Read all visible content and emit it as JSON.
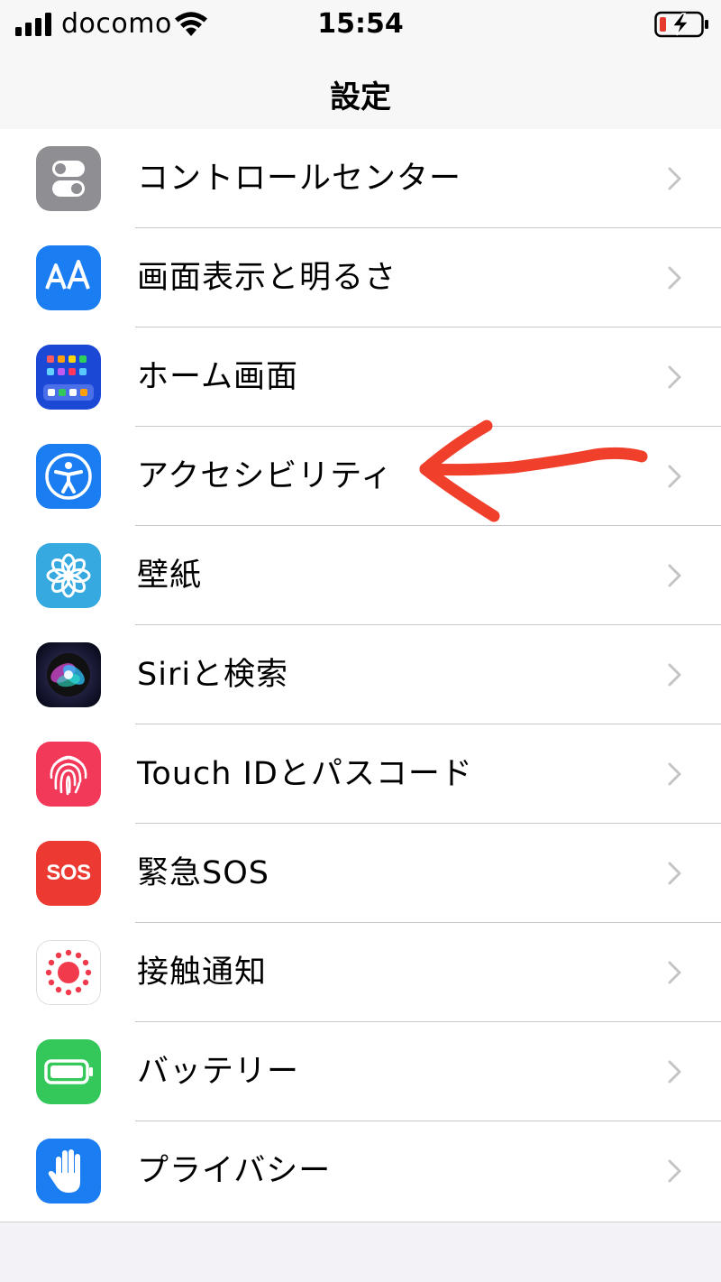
{
  "status_bar": {
    "carrier": "docomo",
    "time": "15:54",
    "signal_icon": "signal-bars-icon",
    "wifi_icon": "wifi-icon",
    "battery_icon": "battery-charging-icon",
    "battery_color": "#e63a2e"
  },
  "nav": {
    "title": "設定"
  },
  "settings": {
    "items": [
      {
        "label": "コントロールセンター",
        "icon": "control-center-icon",
        "color": "#8e8e93"
      },
      {
        "label": "画面表示と明るさ",
        "icon": "display-brightness-icon",
        "color": "#1a7ef2"
      },
      {
        "label": "ホーム画面",
        "icon": "home-screen-icon",
        "color": "#1b49d6"
      },
      {
        "label": "アクセシビリティ",
        "icon": "accessibility-icon",
        "color": "#1a7ef2"
      },
      {
        "label": "壁紙",
        "icon": "wallpaper-icon",
        "color": "#35a9e0"
      },
      {
        "label": "Siriと検索",
        "icon": "siri-icon",
        "color": "#1a1a3a"
      },
      {
        "label": "Touch IDとパスコード",
        "icon": "touch-id-icon",
        "color": "#f2395a"
      },
      {
        "label": "緊急SOS",
        "icon": "sos-icon",
        "color": "#ec3a32",
        "icon_text": "SOS"
      },
      {
        "label": "接触通知",
        "icon": "exposure-notification-icon",
        "color": "#f23a4d"
      },
      {
        "label": "バッテリー",
        "icon": "battery-icon",
        "color": "#34c759"
      },
      {
        "label": "プライバシー",
        "icon": "privacy-hand-icon",
        "color": "#1a7ef2"
      }
    ]
  },
  "annotation": {
    "color": "#f0402c",
    "icon": "red-arrow-annotation"
  }
}
